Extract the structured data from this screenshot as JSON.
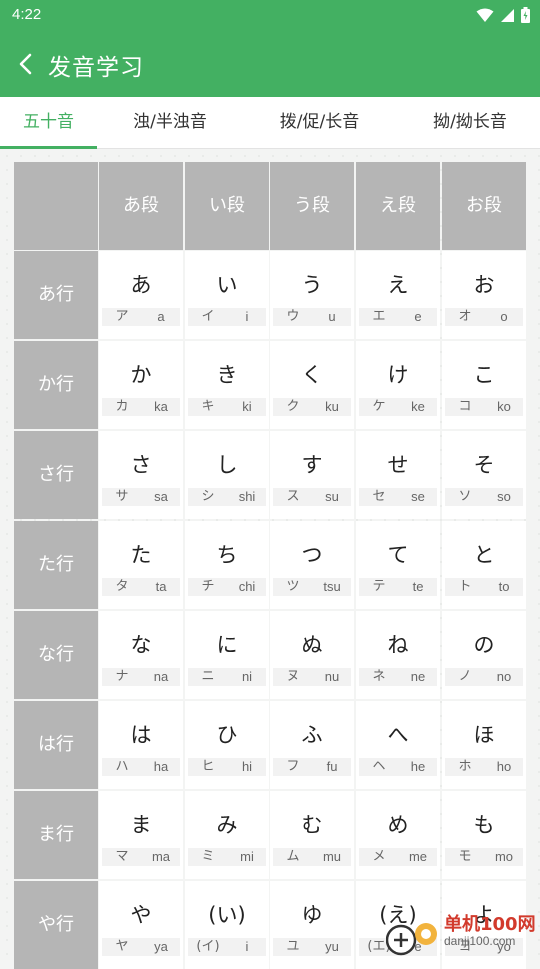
{
  "status": {
    "time": "4:22"
  },
  "appbar": {
    "title": "发音学习"
  },
  "tabs": [
    {
      "label": "五十音"
    },
    {
      "label": "浊/半浊音"
    },
    {
      "label": "拨/促/长音"
    },
    {
      "label": "拗/拗长音"
    }
  ],
  "columns": [
    "あ段",
    "い段",
    "う段",
    "え段",
    "お段"
  ],
  "rows": [
    {
      "label": "あ行",
      "cells": [
        {
          "kana": "あ",
          "kata": "ア",
          "roma": "a"
        },
        {
          "kana": "い",
          "kata": "イ",
          "roma": "i"
        },
        {
          "kana": "う",
          "kata": "ウ",
          "roma": "u"
        },
        {
          "kana": "え",
          "kata": "エ",
          "roma": "e"
        },
        {
          "kana": "お",
          "kata": "オ",
          "roma": "o"
        }
      ]
    },
    {
      "label": "か行",
      "cells": [
        {
          "kana": "か",
          "kata": "カ",
          "roma": "ka"
        },
        {
          "kana": "き",
          "kata": "キ",
          "roma": "ki"
        },
        {
          "kana": "く",
          "kata": "ク",
          "roma": "ku"
        },
        {
          "kana": "け",
          "kata": "ケ",
          "roma": "ke"
        },
        {
          "kana": "こ",
          "kata": "コ",
          "roma": "ko"
        }
      ]
    },
    {
      "label": "さ行",
      "cells": [
        {
          "kana": "さ",
          "kata": "サ",
          "roma": "sa"
        },
        {
          "kana": "し",
          "kata": "シ",
          "roma": "shi"
        },
        {
          "kana": "す",
          "kata": "ス",
          "roma": "su"
        },
        {
          "kana": "せ",
          "kata": "セ",
          "roma": "se"
        },
        {
          "kana": "そ",
          "kata": "ソ",
          "roma": "so"
        }
      ]
    },
    {
      "label": "た行",
      "cells": [
        {
          "kana": "た",
          "kata": "タ",
          "roma": "ta"
        },
        {
          "kana": "ち",
          "kata": "チ",
          "roma": "chi"
        },
        {
          "kana": "つ",
          "kata": "ツ",
          "roma": "tsu"
        },
        {
          "kana": "て",
          "kata": "テ",
          "roma": "te"
        },
        {
          "kana": "と",
          "kata": "ト",
          "roma": "to"
        }
      ]
    },
    {
      "label": "な行",
      "cells": [
        {
          "kana": "な",
          "kata": "ナ",
          "roma": "na"
        },
        {
          "kana": "に",
          "kata": "ニ",
          "roma": "ni"
        },
        {
          "kana": "ぬ",
          "kata": "ヌ",
          "roma": "nu"
        },
        {
          "kana": "ね",
          "kata": "ネ",
          "roma": "ne"
        },
        {
          "kana": "の",
          "kata": "ノ",
          "roma": "no"
        }
      ]
    },
    {
      "label": "は行",
      "cells": [
        {
          "kana": "は",
          "kata": "ハ",
          "roma": "ha"
        },
        {
          "kana": "ひ",
          "kata": "ヒ",
          "roma": "hi"
        },
        {
          "kana": "ふ",
          "kata": "フ",
          "roma": "fu"
        },
        {
          "kana": "へ",
          "kata": "ヘ",
          "roma": "he"
        },
        {
          "kana": "ほ",
          "kata": "ホ",
          "roma": "ho"
        }
      ]
    },
    {
      "label": "ま行",
      "cells": [
        {
          "kana": "ま",
          "kata": "マ",
          "roma": "ma"
        },
        {
          "kana": "み",
          "kata": "ミ",
          "roma": "mi"
        },
        {
          "kana": "む",
          "kata": "ム",
          "roma": "mu"
        },
        {
          "kana": "め",
          "kata": "メ",
          "roma": "me"
        },
        {
          "kana": "も",
          "kata": "モ",
          "roma": "mo"
        }
      ]
    },
    {
      "label": "や行",
      "cells": [
        {
          "kana": "や",
          "kata": "ヤ",
          "roma": "ya"
        },
        {
          "kana": "(い)",
          "kata": "(イ)",
          "roma": "i"
        },
        {
          "kana": "ゆ",
          "kata": "ユ",
          "roma": "yu"
        },
        {
          "kana": "(え)",
          "kata": "(エ)",
          "roma": "e"
        },
        {
          "kana": "よ",
          "kata": "ヨ",
          "roma": "yo"
        }
      ]
    }
  ],
  "watermark": {
    "text": "单机100网",
    "url": "danji100.com"
  },
  "colors": {
    "brand": "#43b062",
    "header_cell": "#b5b5b5"
  },
  "icons": {
    "back": "chevron-left-icon",
    "wifi": "wifi-icon",
    "signal": "signal-icon",
    "battery": "battery-icon"
  }
}
